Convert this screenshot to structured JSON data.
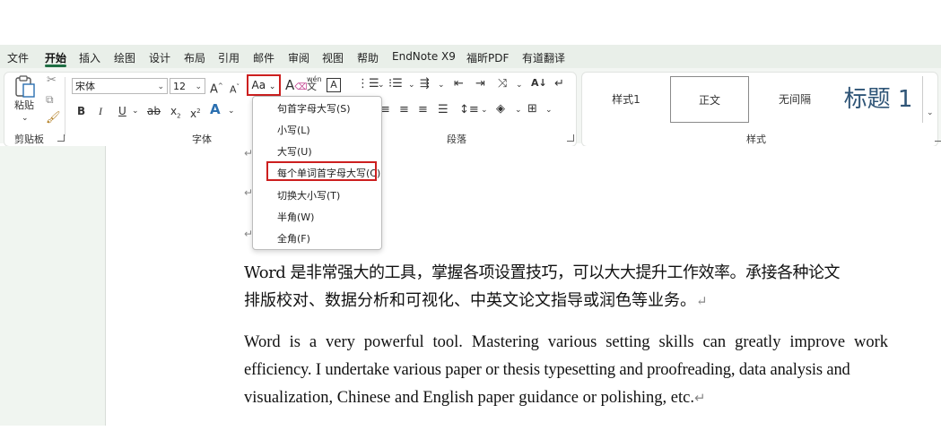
{
  "menu": {
    "tabs": [
      "文件",
      "开始",
      "插入",
      "绘图",
      "设计",
      "布局",
      "引用",
      "邮件",
      "审阅",
      "视图",
      "帮助",
      "EndNote X9",
      "福昕PDF",
      "有道翻译"
    ],
    "active": "开始"
  },
  "ribbon": {
    "clipboard": {
      "paste_label": "粘贴",
      "group_label": "剪贴板"
    },
    "font": {
      "font_name": "宋体",
      "font_size": "12",
      "group_label": "字体",
      "grow_label": "A",
      "shrink_label": "A",
      "change_case_label": "Aa",
      "bold_label": "B",
      "italic_label": "I",
      "underline_label": "U",
      "strike_label": "ab",
      "subscript_label": "x",
      "superscript_label": "x",
      "effects_label": "A",
      "phonetic_label": "wén",
      "border_char_label": "A"
    },
    "paragraph": {
      "group_label": "段落",
      "sort_label": "A↓"
    },
    "styles": {
      "group_label": "样式",
      "items": [
        "样式1",
        "正文",
        "无间隔",
        "标题 1"
      ]
    }
  },
  "change_case_menu": {
    "items": [
      "句首字母大写(S)",
      "小写(L)",
      "大写(U)",
      "每个单词首字母大写(C)",
      "切换大小写(T)",
      "半角(W)",
      "全角(F)"
    ],
    "highlighted_index": 3
  },
  "document": {
    "cn_line1": "Word 是非常强大的工具，掌握各项设置技巧，可以大大提升工作效率。承接各种论文",
    "cn_line2": "排版校对、数据分析和可视化、中英文论文指导或润色等业务。",
    "en_line1": "Word is a very powerful tool. Mastering various setting skills can greatly improve work",
    "en_line2": "efficiency. I undertake various paper or thesis typesetting and proofreading, data analysis and",
    "en_line3": "visualization, Chinese and English paper guidance or polishing, etc.",
    "paragraph_mark": "↵"
  },
  "colors": {
    "accent": "#1f6e43",
    "highlight_red": "#cc1f1f",
    "heading_blue": "#2f5577",
    "ribbon_bg": "#f3f6f3",
    "menubar_bg": "#e9efe9"
  }
}
